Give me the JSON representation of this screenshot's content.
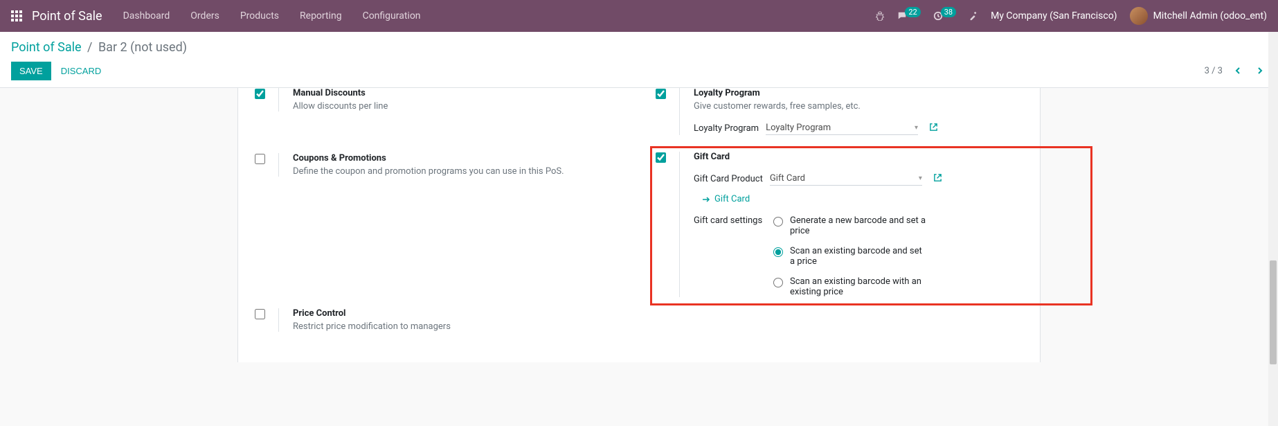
{
  "nav": {
    "app_title": "Point of Sale",
    "items": [
      "Dashboard",
      "Orders",
      "Products",
      "Reporting",
      "Configuration"
    ],
    "msg_badge": "22",
    "activity_badge": "38",
    "company": "My Company (San Francisco)",
    "user": "Mitchell Admin (odoo_ent)"
  },
  "breadcrumb": {
    "root": "Point of Sale",
    "current": "Bar 2 (not used)"
  },
  "actions": {
    "save": "SAVE",
    "discard": "DISCARD"
  },
  "pager": {
    "text": "3 / 3"
  },
  "settings": {
    "manual_discounts": {
      "title": "Manual Discounts",
      "desc": "Allow discounts per line"
    },
    "coupons": {
      "title": "Coupons & Promotions",
      "desc": "Define the coupon and promotion programs you can use in this PoS."
    },
    "price_control": {
      "title": "Price Control",
      "desc": "Restrict price modification to managers"
    },
    "loyalty": {
      "title": "Loyalty Program",
      "desc": "Give customer rewards, free samples, etc.",
      "field_label": "Loyalty Program",
      "field_value": "Loyalty Program"
    },
    "gift_card": {
      "title": "Gift Card",
      "product_label": "Gift Card Product",
      "product_value": "Gift Card",
      "link": "Gift Card",
      "settings_label": "Gift card settings",
      "opt1": "Generate a new barcode and set a price",
      "opt2": "Scan an existing barcode and set a price",
      "opt3": "Scan an existing barcode with an existing price"
    }
  }
}
